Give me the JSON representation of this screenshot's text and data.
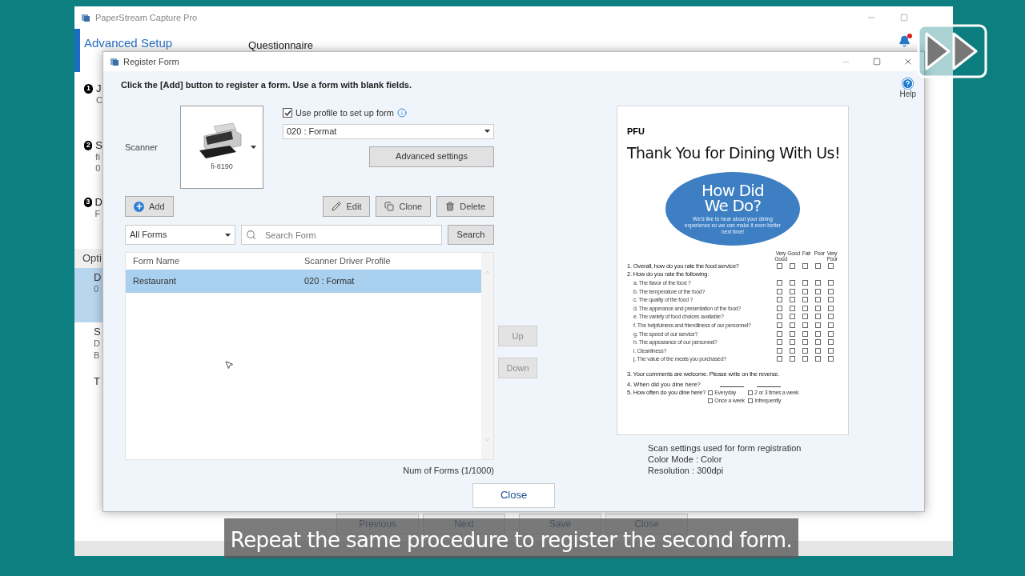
{
  "background_window": {
    "title": "PaperStream Capture Pro",
    "header": "Advanced Setup",
    "page_title": "Questionnaire",
    "steps": [
      {
        "number": "1",
        "lines": [
          "J",
          "C"
        ]
      },
      {
        "number": "2",
        "lines": [
          "S",
          "fi",
          "0"
        ]
      },
      {
        "number": "3",
        "lines": [
          "D",
          "F"
        ]
      }
    ],
    "options_header": "Opti",
    "options": [
      {
        "lines": [
          "D",
          "0"
        ],
        "selected": true
      },
      {
        "lines": [
          "S",
          "D",
          "B"
        ],
        "selected": false
      },
      {
        "lines": [
          "T"
        ],
        "selected": false
      }
    ],
    "buttons": [
      "Previous",
      "Next",
      "Save",
      "Close"
    ]
  },
  "dialog": {
    "title": "Register Form",
    "instruction": "Click the [Add] button to register a form. Use a form with blank fields.",
    "help": "Help",
    "scanner_label": "Scanner",
    "scanner_model": "fi-8190",
    "use_profile": {
      "label": "Use profile to set up form",
      "checked": true
    },
    "profile_select": "020 : Format",
    "advanced_button": "Advanced settings",
    "actions": [
      {
        "kind": "add",
        "label": "Add"
      },
      {
        "kind": "edit",
        "label": "Edit"
      },
      {
        "kind": "clone",
        "label": "Clone"
      },
      {
        "kind": "delete",
        "label": "Delete"
      }
    ],
    "filter_select": "All Forms",
    "search": {
      "placeholder": "Search Form"
    },
    "search_button": "Search",
    "table": {
      "columns": [
        "Form Name",
        "Scanner Driver Profile"
      ],
      "rows": [
        {
          "form_name": "Restaurant",
          "profile": "020 : Format",
          "selected": true
        }
      ]
    },
    "move_buttons": [
      {
        "label": "Up",
        "disabled": true
      },
      {
        "label": "Down",
        "disabled": true
      }
    ],
    "count": "Num of Forms (1/1000)",
    "close_button": "Close",
    "preview": {
      "brand": "PFU",
      "title": "Thank You for Dining With Us!",
      "oval_title": [
        "How Did",
        "We Do?"
      ],
      "oval_text": "We'd like to hear about your dining experience so we can make it even better next time!",
      "rating_columns": [
        "Very Good",
        "Good",
        "Fair",
        "Poor",
        "Very Poor"
      ],
      "questions": [
        {
          "kind": "rated",
          "text": "1.  Overall, how do you rate the food service?"
        },
        {
          "kind": "heading",
          "text": "2. How do you rate the following:"
        },
        {
          "kind": "sub",
          "text": "a. The flavor of the food ?"
        },
        {
          "kind": "sub",
          "text": "b. The temperature of the food?"
        },
        {
          "kind": "sub",
          "text": "c. The quality of the food ?"
        },
        {
          "kind": "sub",
          "text": "d. The apperance and presentation of the food?"
        },
        {
          "kind": "sub",
          "text": "e. The variety of food choices available?"
        },
        {
          "kind": "sub",
          "text": "f. The helpfulness and friendliness of our personnel?"
        },
        {
          "kind": "sub",
          "text": "g. The speed of our service?"
        },
        {
          "kind": "sub",
          "text": "h. The appearance of our personnel?"
        },
        {
          "kind": "sub",
          "text": "i. Cleanliness?"
        },
        {
          "kind": "sub",
          "text": "j. The value of the meals you purchased?"
        }
      ],
      "comments": "3. Your comments are welcome. Please  write on the reverse.",
      "when": "4. When did you dine here?",
      "often": "5. How often do you dine here?",
      "often_options": [
        "Everyday",
        "2 or 3 times a week",
        "Once a week",
        "Infrequently"
      ]
    },
    "scan_settings": [
      "Scan settings used for form registration",
      "Color Mode : Color",
      "Resolution : 300dpi"
    ]
  },
  "caption": "Repeat the same procedure to register the second form."
}
